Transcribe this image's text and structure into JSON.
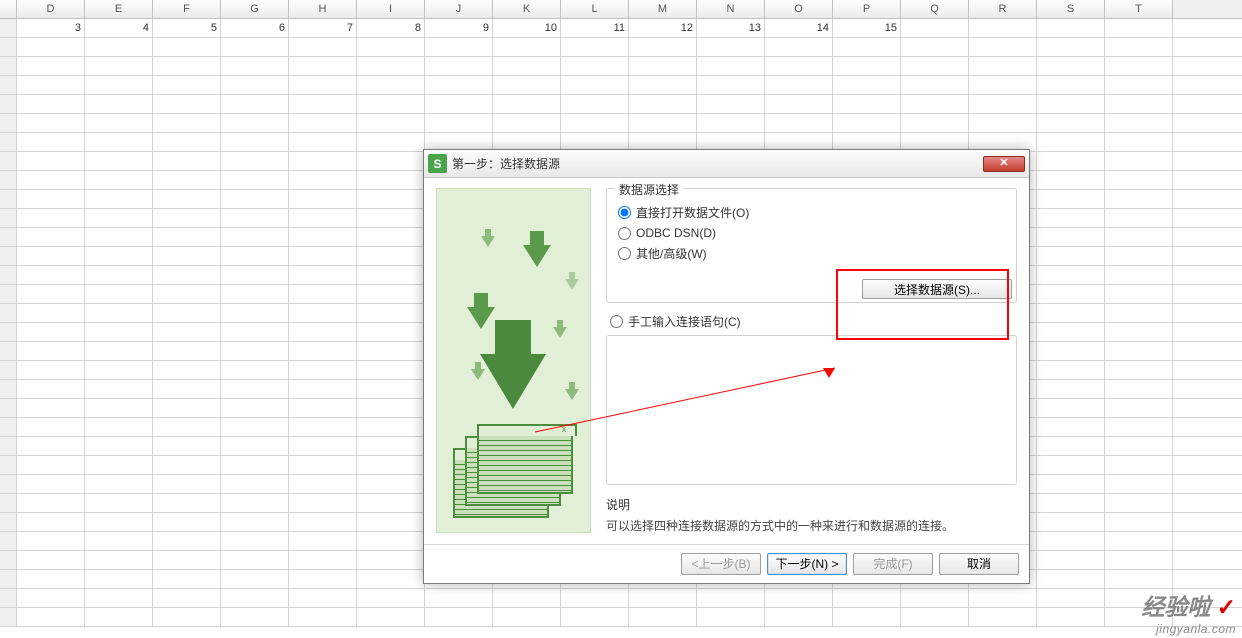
{
  "sheet": {
    "columns_start_letter": "D",
    "columns": [
      "D",
      "E",
      "F",
      "G",
      "H",
      "I",
      "J",
      "K",
      "L",
      "M",
      "N",
      "O",
      "P",
      "Q",
      "R",
      "S",
      "T"
    ],
    "row1": [
      "3",
      "4",
      "5",
      "6",
      "7",
      "8",
      "9",
      "10",
      "11",
      "12",
      "13",
      "14",
      "15",
      "",
      "",
      "",
      ""
    ]
  },
  "dialog": {
    "title": "第一步：选择数据源",
    "icon_letter": "S",
    "group_title": "数据源选择",
    "option_open": "直接打开数据文件(O)",
    "option_odbc": "ODBC DSN(D)",
    "option_other": "其他/高级(W)",
    "btn_select_source": "选择数据源(S)...",
    "option_manual": "手工输入连接语句(C)",
    "desc_title": "说明",
    "desc_text": "可以选择四种连接数据源的方式中的一种来进行和数据源的连接。",
    "btn_prev": "<上一步(B)",
    "btn_next": "下一步(N) >",
    "btn_finish": "完成(F)",
    "btn_cancel": "取消",
    "close_x": "✕"
  },
  "watermark": {
    "main": "经验啦",
    "check": "✓",
    "sub": "jingyanla.com"
  }
}
